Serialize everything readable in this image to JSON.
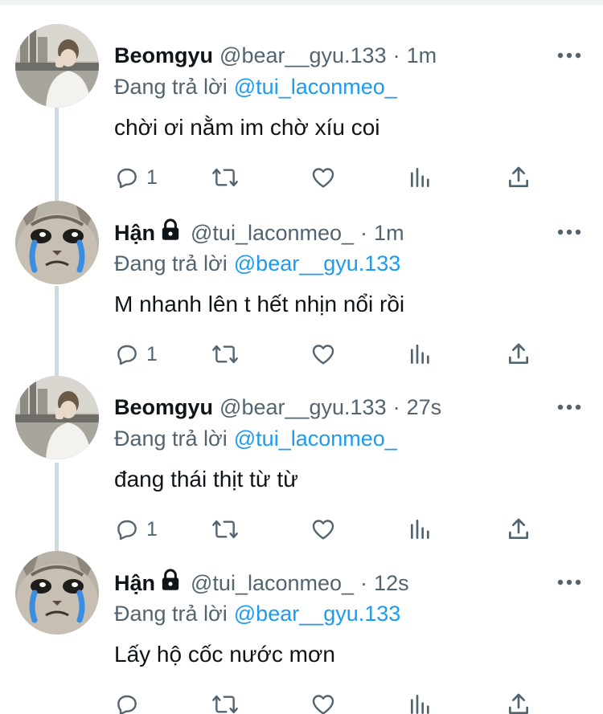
{
  "reply_prefix": "Đang trả lời",
  "tweets": [
    {
      "name": "Beomgyu",
      "handle": "@bear__gyu.133",
      "dot": "·",
      "time": "1m",
      "replying_to": "@tui_laconmeo_",
      "text": "chời ơi nằm im chờ xíu coi",
      "reply_count": "1",
      "avatar": "photo-person",
      "locked": false
    },
    {
      "name": "Hận",
      "handle": "@tui_laconmeo_",
      "dot": "·",
      "time": "1m",
      "replying_to": "@bear__gyu.133",
      "text": "M nhanh lên t hết nhịn nổi rồi",
      "reply_count": "1",
      "avatar": "crying-cat",
      "locked": true
    },
    {
      "name": "Beomgyu",
      "handle": "@bear__gyu.133",
      "dot": "·",
      "time": "27s",
      "replying_to": "@tui_laconmeo_",
      "text": "đang thái thịt từ từ",
      "reply_count": "1",
      "avatar": "photo-person",
      "locked": false
    },
    {
      "name": "Hận",
      "handle": "@tui_laconmeo_",
      "dot": "·",
      "time": "12s",
      "replying_to": "@bear__gyu.133",
      "text": "Lấy hộ cốc nước mơn",
      "reply_count": "",
      "avatar": "crying-cat",
      "locked": true
    }
  ],
  "colors": {
    "text": "#0f1419",
    "secondary": "#536471",
    "link": "#1d9bf0",
    "thread_line": "#cfd9de"
  }
}
